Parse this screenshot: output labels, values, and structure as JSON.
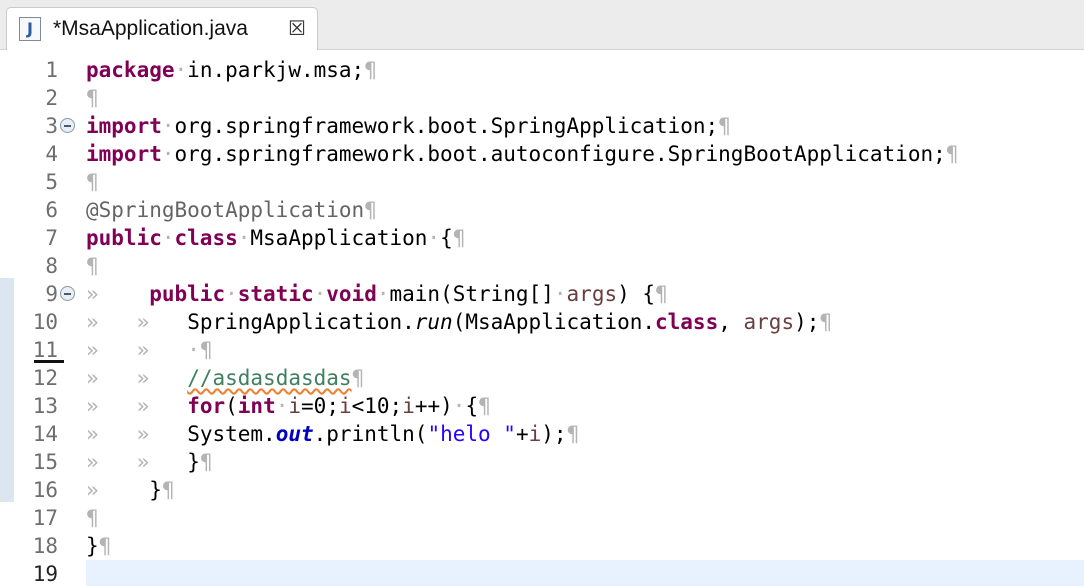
{
  "editor_tab": {
    "icon_glyph": "J",
    "title": "*MsaApplication.java",
    "close_glyph": "☒"
  },
  "gutter": {
    "line_numbers": [
      "1",
      "2",
      "3",
      "4",
      "5",
      "6",
      "7",
      "8",
      "9",
      "10",
      "11",
      "12",
      "13",
      "14",
      "15",
      "16",
      "17",
      "18",
      "19"
    ]
  },
  "code_tokens": {
    "package": "package",
    "package_name": "in.parkjw.msa;",
    "import": "import",
    "import1": "org.springframework.boot.SpringApplication;",
    "import2": "org.springframework.boot.autoconfigure.SpringBootApplication;",
    "annotation": "@SpringBootApplication",
    "public": "public",
    "class": "class",
    "class_name": "MsaApplication",
    "brace_open": "{",
    "brace_close": "}",
    "static": "static",
    "void": "void",
    "main_sig": "main(String[]",
    "args": "args",
    "paren_brace": ") {",
    "spring_app": "SpringApplication.",
    "run": "run",
    "run_arg": "(MsaApplication.",
    "comma": ", ",
    "close_stmt": ");",
    "comment": "//asdasdasdas",
    "for": "for",
    "int": "int",
    "loop_i1": "i",
    "loop_mid1": "=0;",
    "loop_i2": "i",
    "loop_mid2": "<10;",
    "loop_i3": "i",
    "loop_end": "++)",
    "system": "System.",
    "out": "out",
    "println": ".println(",
    "string_lit": "\"helo \"",
    "plus": "+",
    "print_i": "i",
    "pilcrow": "¶",
    "tab_arrow": "»",
    "space_dot": "·"
  },
  "colors": {
    "keyword": "#7f0055",
    "annotation": "#646464",
    "string": "#2a00ff",
    "comment": "#3f7f5f",
    "field": "#0000c0",
    "local_var": "#6a3e3e",
    "current_line": "#e8f2fe"
  }
}
